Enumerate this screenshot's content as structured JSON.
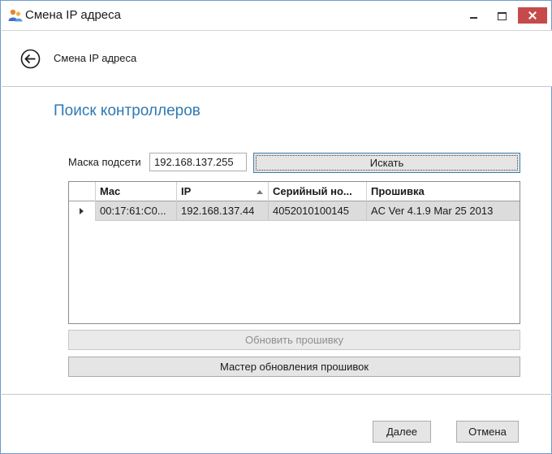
{
  "window": {
    "title": "Смена IP адреса",
    "icon": "users-icon",
    "controls": [
      "minimize-icon",
      "maximize-icon",
      "close-icon"
    ],
    "close_color": "#c74a4a"
  },
  "nav": {
    "back_icon": "back-arrow-icon",
    "title": "Смена IP адреса"
  },
  "main": {
    "section_title": "Поиск контроллеров",
    "mask_label": "Маска подсети",
    "mask_value": "192.168.137.255",
    "search_button": "Искать"
  },
  "grid": {
    "columns": [
      "Mac",
      "IP",
      "Серийный но...",
      "Прошивка"
    ],
    "sorted_column": "IP",
    "rows": [
      {
        "mac": "00:17:61:C0...",
        "ip": "192.168.137.44",
        "serial": "4052010100145",
        "firmware": "AC Ver 4.1.9 Mar 25 2013"
      }
    ]
  },
  "actions": {
    "update_firmware": "Обновить прошивку",
    "firmware_wizard": "Мастер обновления прошивок"
  },
  "footer": {
    "next": "Далее",
    "cancel": "Отмена"
  },
  "colors": {
    "accent": "#2f79b3",
    "selected_row": "#dcdcdc"
  }
}
